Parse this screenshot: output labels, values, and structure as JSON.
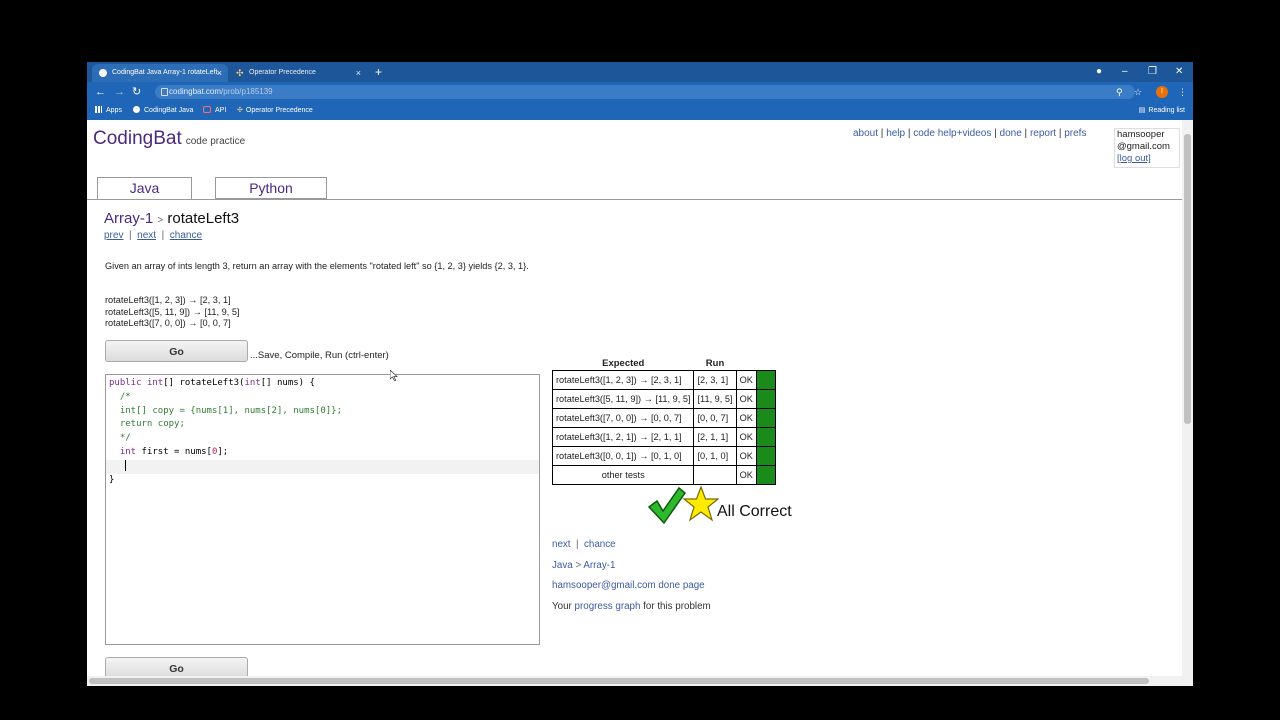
{
  "browser": {
    "tabs": [
      {
        "title": "CodingBat Java Array-1 rotateLeft",
        "close": "×"
      },
      {
        "title": "Operator Precedence",
        "close": "×"
      }
    ],
    "new_tab": "+",
    "window_controls": {
      "minimize": "–",
      "restore": "❐",
      "close": "✕"
    },
    "url_host": "codingbat.com",
    "url_path": "/prob/p185139",
    "profile_initial": "I",
    "bookmarks": [
      "Apps",
      "CodingBat Java",
      "API",
      "Operator Precedence"
    ],
    "reading_list": "Reading list",
    "nav_glyphs": {
      "back": "←",
      "forward": "→",
      "reload": "↻"
    }
  },
  "site": {
    "logo": "CodingBat",
    "logo_sub": "code practice",
    "toplinks": [
      "about",
      "help",
      "code help+videos",
      "done",
      "report",
      "prefs"
    ],
    "user_line1": "hamsooper",
    "user_line2": "@gmail.com",
    "logout": "[log out]"
  },
  "lang_tabs": [
    "Java",
    "Python"
  ],
  "problem": {
    "category": "Array-1",
    "sep": ">",
    "name": "rotateLeft3",
    "prev": "prev",
    "next": "next",
    "chance": "chance",
    "description": "Given an array of ints length 3, return an array with the elements \"rotated left\" so {1, 2, 3} yields {2, 3, 1}.",
    "examples": [
      "rotateLeft3([1, 2, 3]) → [2, 3, 1]",
      "rotateLeft3([5, 11, 9]) → [11, 9, 5]",
      "rotateLeft3([7, 0, 0]) → [0, 0, 7]"
    ]
  },
  "go_button": "Go",
  "go_hint": "...Save, Compile, Run (ctrl-enter)",
  "code": {
    "line1_kw1": "public",
    "line1_kw2": "int",
    "line1_rest": "[] rotateLeft3(",
    "line1_kw3": "int",
    "line1_end": "[] nums) {",
    "comment_open": "/*",
    "comment_line1": "int[] copy = {nums[1], nums[2], nums[0]};",
    "comment_line2": "return copy;",
    "comment_close": "*/",
    "line_first_kw": "int",
    "line_first_mid": " first = nums[",
    "line_first_num": "0",
    "line_first_end": "];",
    "closing": "}"
  },
  "results": {
    "header_expected": "Expected",
    "header_run": "Run",
    "rows": [
      {
        "expected": "rotateLeft3([1, 2, 3]) → [2, 3, 1]",
        "run": "[2, 3, 1]",
        "status": "OK"
      },
      {
        "expected": "rotateLeft3([5, 11, 9]) → [11, 9, 5]",
        "run": "[11, 9, 5]",
        "status": "OK"
      },
      {
        "expected": "rotateLeft3([7, 0, 0]) → [0, 0, 7]",
        "run": "[0, 0, 7]",
        "status": "OK"
      },
      {
        "expected": "rotateLeft3([1, 2, 1]) → [2, 1, 1]",
        "run": "[2, 1, 1]",
        "status": "OK"
      },
      {
        "expected": "rotateLeft3([0, 0, 1]) → [0, 1, 0]",
        "run": "[0, 1, 0]",
        "status": "OK"
      }
    ],
    "other_label": "other tests",
    "other_status": "OK",
    "pass_color": "#1a8a1a"
  },
  "all_correct": "All Correct",
  "bottom": {
    "next": "next",
    "chance": "chance",
    "java": "Java",
    "gt": ">",
    "array1": "Array-1",
    "done_page": "hamsooper@gmail.com done page",
    "progress_prefix": "Your",
    "progress_link": "progress graph",
    "progress_suffix": "for this problem"
  },
  "colors": {
    "brand": "#4b2a7f",
    "link": "#3b5ba0",
    "chrome": "#2066b8"
  }
}
